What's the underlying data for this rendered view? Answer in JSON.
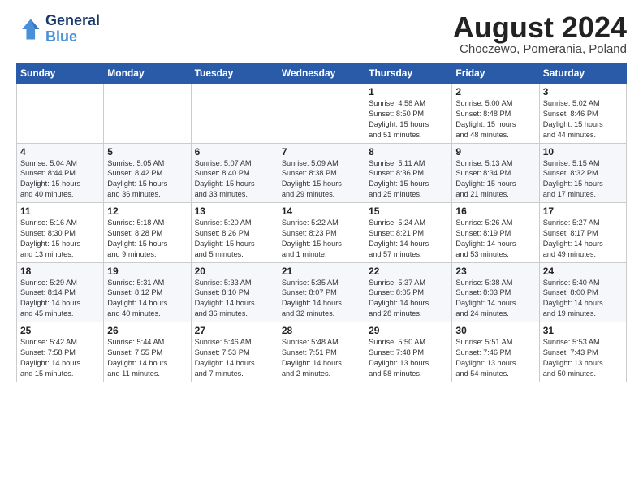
{
  "header": {
    "logo_line1": "General",
    "logo_line2": "Blue",
    "month_title": "August 2024",
    "location": "Choczewo, Pomerania, Poland"
  },
  "weekdays": [
    "Sunday",
    "Monday",
    "Tuesday",
    "Wednesday",
    "Thursday",
    "Friday",
    "Saturday"
  ],
  "weeks": [
    [
      {
        "day": "",
        "info": ""
      },
      {
        "day": "",
        "info": ""
      },
      {
        "day": "",
        "info": ""
      },
      {
        "day": "",
        "info": ""
      },
      {
        "day": "1",
        "info": "Sunrise: 4:58 AM\nSunset: 8:50 PM\nDaylight: 15 hours\nand 51 minutes."
      },
      {
        "day": "2",
        "info": "Sunrise: 5:00 AM\nSunset: 8:48 PM\nDaylight: 15 hours\nand 48 minutes."
      },
      {
        "day": "3",
        "info": "Sunrise: 5:02 AM\nSunset: 8:46 PM\nDaylight: 15 hours\nand 44 minutes."
      }
    ],
    [
      {
        "day": "4",
        "info": "Sunrise: 5:04 AM\nSunset: 8:44 PM\nDaylight: 15 hours\nand 40 minutes."
      },
      {
        "day": "5",
        "info": "Sunrise: 5:05 AM\nSunset: 8:42 PM\nDaylight: 15 hours\nand 36 minutes."
      },
      {
        "day": "6",
        "info": "Sunrise: 5:07 AM\nSunset: 8:40 PM\nDaylight: 15 hours\nand 33 minutes."
      },
      {
        "day": "7",
        "info": "Sunrise: 5:09 AM\nSunset: 8:38 PM\nDaylight: 15 hours\nand 29 minutes."
      },
      {
        "day": "8",
        "info": "Sunrise: 5:11 AM\nSunset: 8:36 PM\nDaylight: 15 hours\nand 25 minutes."
      },
      {
        "day": "9",
        "info": "Sunrise: 5:13 AM\nSunset: 8:34 PM\nDaylight: 15 hours\nand 21 minutes."
      },
      {
        "day": "10",
        "info": "Sunrise: 5:15 AM\nSunset: 8:32 PM\nDaylight: 15 hours\nand 17 minutes."
      }
    ],
    [
      {
        "day": "11",
        "info": "Sunrise: 5:16 AM\nSunset: 8:30 PM\nDaylight: 15 hours\nand 13 minutes."
      },
      {
        "day": "12",
        "info": "Sunrise: 5:18 AM\nSunset: 8:28 PM\nDaylight: 15 hours\nand 9 minutes."
      },
      {
        "day": "13",
        "info": "Sunrise: 5:20 AM\nSunset: 8:26 PM\nDaylight: 15 hours\nand 5 minutes."
      },
      {
        "day": "14",
        "info": "Sunrise: 5:22 AM\nSunset: 8:23 PM\nDaylight: 15 hours\nand 1 minute."
      },
      {
        "day": "15",
        "info": "Sunrise: 5:24 AM\nSunset: 8:21 PM\nDaylight: 14 hours\nand 57 minutes."
      },
      {
        "day": "16",
        "info": "Sunrise: 5:26 AM\nSunset: 8:19 PM\nDaylight: 14 hours\nand 53 minutes."
      },
      {
        "day": "17",
        "info": "Sunrise: 5:27 AM\nSunset: 8:17 PM\nDaylight: 14 hours\nand 49 minutes."
      }
    ],
    [
      {
        "day": "18",
        "info": "Sunrise: 5:29 AM\nSunset: 8:14 PM\nDaylight: 14 hours\nand 45 minutes."
      },
      {
        "day": "19",
        "info": "Sunrise: 5:31 AM\nSunset: 8:12 PM\nDaylight: 14 hours\nand 40 minutes."
      },
      {
        "day": "20",
        "info": "Sunrise: 5:33 AM\nSunset: 8:10 PM\nDaylight: 14 hours\nand 36 minutes."
      },
      {
        "day": "21",
        "info": "Sunrise: 5:35 AM\nSunset: 8:07 PM\nDaylight: 14 hours\nand 32 minutes."
      },
      {
        "day": "22",
        "info": "Sunrise: 5:37 AM\nSunset: 8:05 PM\nDaylight: 14 hours\nand 28 minutes."
      },
      {
        "day": "23",
        "info": "Sunrise: 5:38 AM\nSunset: 8:03 PM\nDaylight: 14 hours\nand 24 minutes."
      },
      {
        "day": "24",
        "info": "Sunrise: 5:40 AM\nSunset: 8:00 PM\nDaylight: 14 hours\nand 19 minutes."
      }
    ],
    [
      {
        "day": "25",
        "info": "Sunrise: 5:42 AM\nSunset: 7:58 PM\nDaylight: 14 hours\nand 15 minutes."
      },
      {
        "day": "26",
        "info": "Sunrise: 5:44 AM\nSunset: 7:55 PM\nDaylight: 14 hours\nand 11 minutes."
      },
      {
        "day": "27",
        "info": "Sunrise: 5:46 AM\nSunset: 7:53 PM\nDaylight: 14 hours\nand 7 minutes."
      },
      {
        "day": "28",
        "info": "Sunrise: 5:48 AM\nSunset: 7:51 PM\nDaylight: 14 hours\nand 2 minutes."
      },
      {
        "day": "29",
        "info": "Sunrise: 5:50 AM\nSunset: 7:48 PM\nDaylight: 13 hours\nand 58 minutes."
      },
      {
        "day": "30",
        "info": "Sunrise: 5:51 AM\nSunset: 7:46 PM\nDaylight: 13 hours\nand 54 minutes."
      },
      {
        "day": "31",
        "info": "Sunrise: 5:53 AM\nSunset: 7:43 PM\nDaylight: 13 hours\nand 50 minutes."
      }
    ]
  ]
}
